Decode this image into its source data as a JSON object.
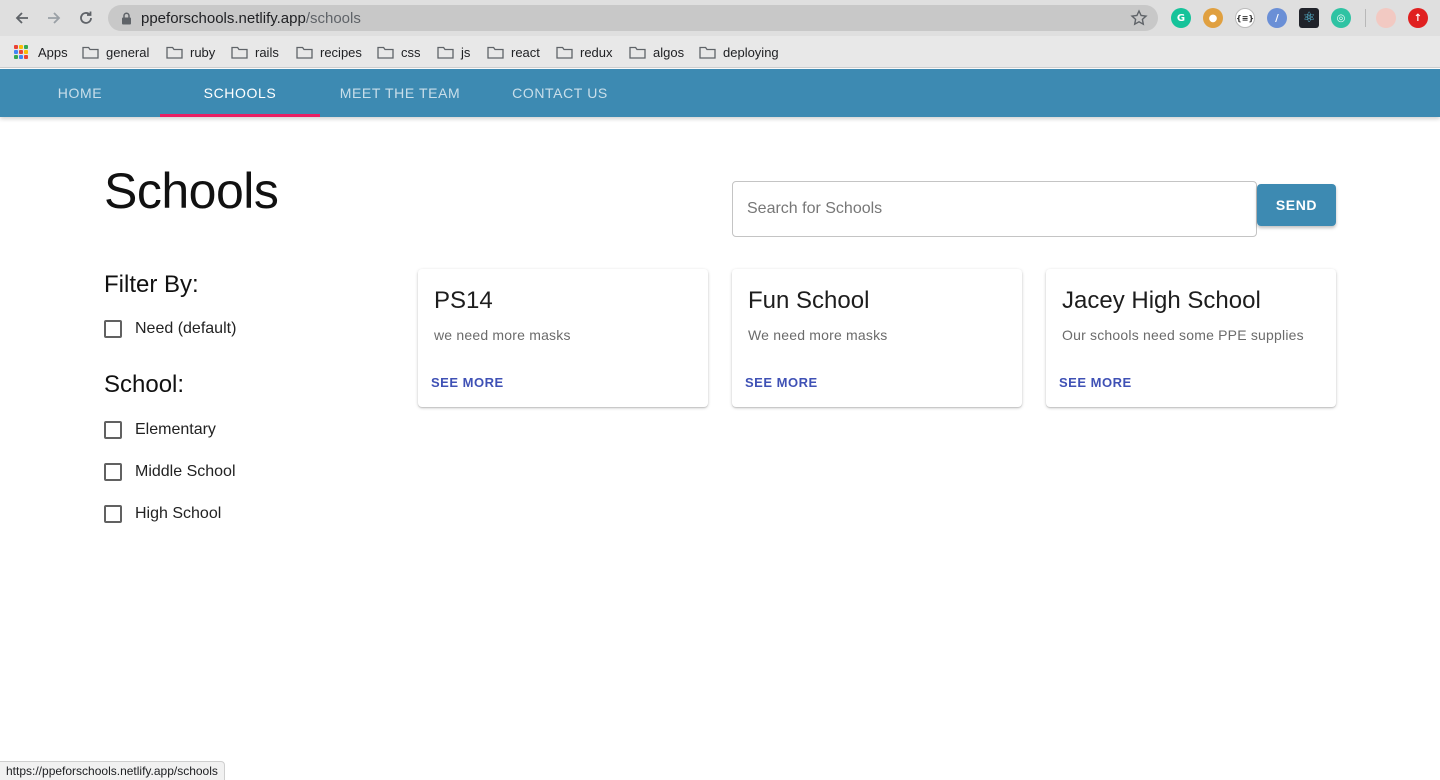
{
  "browser": {
    "url_host": "ppeforschools.netlify.app",
    "url_path": "/schools",
    "bookmarks": {
      "apps": "Apps",
      "folders": [
        "general",
        "ruby",
        "rails",
        "recipes",
        "css",
        "js",
        "react",
        "redux",
        "algos",
        "deploying"
      ]
    },
    "extensions": [
      {
        "name": "grammarly-icon",
        "color": "#15c39a",
        "glyph": "G"
      },
      {
        "name": "cookie-icon",
        "color": "#e0a040",
        "glyph": "●"
      },
      {
        "name": "json-viewer-icon",
        "color": "#ffffff",
        "glyph": "{≡}"
      },
      {
        "name": "compass-icon",
        "color": "#6a8fd6",
        "glyph": "/"
      },
      {
        "name": "react-devtools-icon",
        "color": "#20232a",
        "glyph": "⚛"
      },
      {
        "name": "target-icon",
        "color": "#2fc3a3",
        "glyph": "◎"
      },
      {
        "name": "profile-avatar-icon",
        "color": "#f2c9c2",
        "glyph": ""
      },
      {
        "name": "update-icon",
        "color": "#e02020",
        "glyph": "↑"
      }
    ],
    "status_text": "https://ppeforschools.netlify.app/schools"
  },
  "nav": {
    "tabs": [
      "HOME",
      "SCHOOLS",
      "MEET THE TEAM",
      "CONTACT US"
    ],
    "active_index": 1,
    "bar_color": "#3d8ab2",
    "indicator_color": "#e91e63"
  },
  "main": {
    "title": "Schools",
    "search_placeholder": "Search for Schools",
    "send_label": "SEND",
    "filter_heading": "Filter By:",
    "need_label": "Need (default)",
    "school_heading": "School:",
    "school_types": [
      "Elementary",
      "Middle School",
      "High School"
    ],
    "cards": [
      {
        "title": "PS14",
        "description": "we need more masks",
        "action": "SEE MORE"
      },
      {
        "title": "Fun School",
        "description": "We need more masks",
        "action": "SEE MORE"
      },
      {
        "title": "Jacey High School",
        "description": "Our schools need some PPE supplies",
        "action": "SEE MORE"
      }
    ]
  }
}
